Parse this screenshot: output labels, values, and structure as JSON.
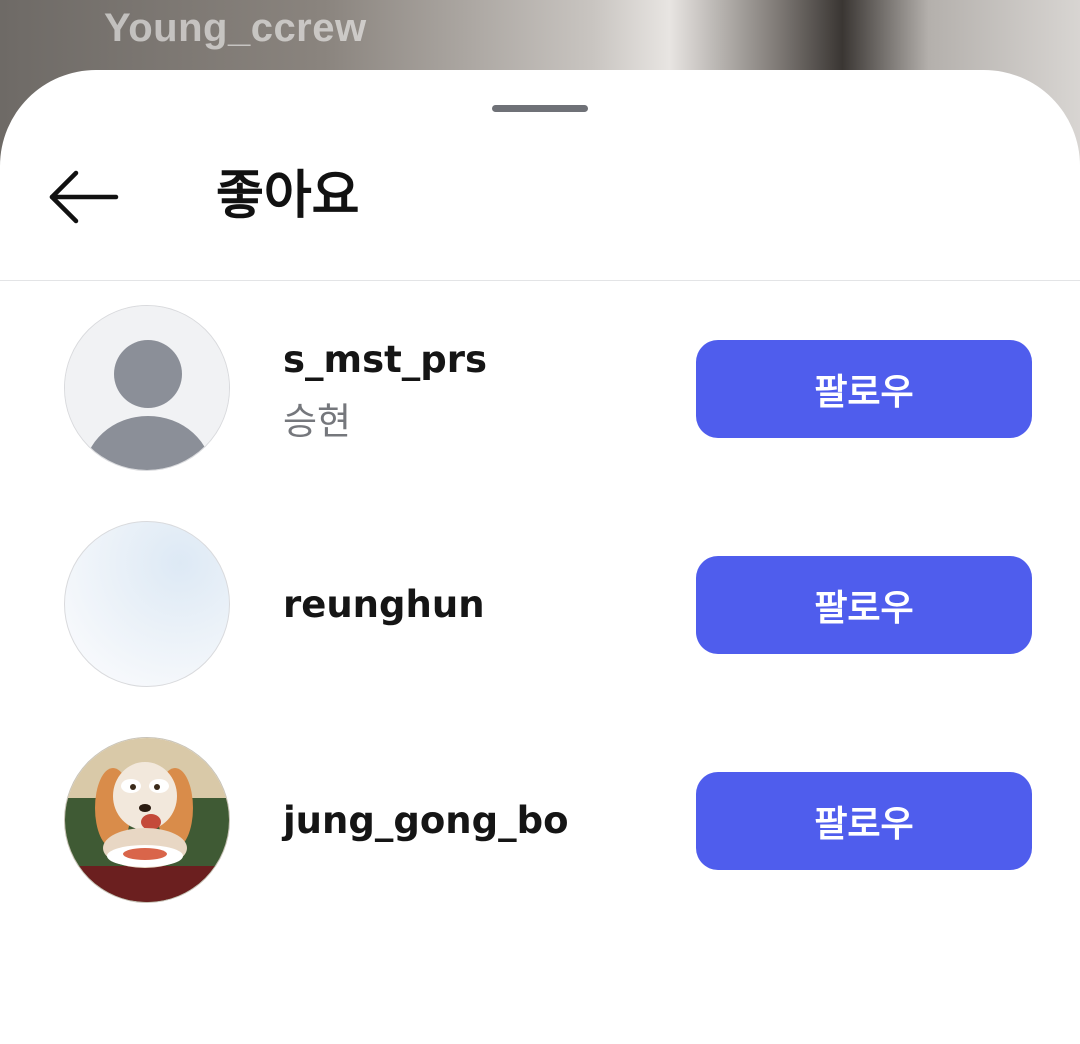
{
  "background": {
    "watermark": "Young_ccrew"
  },
  "header": {
    "back_icon": "arrow-left-icon",
    "title": "좋아요"
  },
  "likes": [
    {
      "username": "s_mst_prs",
      "name": "승현",
      "avatar": "default-person-avatar",
      "follow_label": "팔로우"
    },
    {
      "username": "reunghun",
      "name": "",
      "avatar": "light-blue-gradient-avatar",
      "follow_label": "팔로우"
    },
    {
      "username": "jung_gong_bo",
      "name": "",
      "avatar": "cartoon-dog-avatar",
      "follow_label": "팔로우"
    }
  ],
  "colors": {
    "follow_button": "#4f5ded",
    "sheet": "#ffffff",
    "subtext": "#75777c"
  }
}
